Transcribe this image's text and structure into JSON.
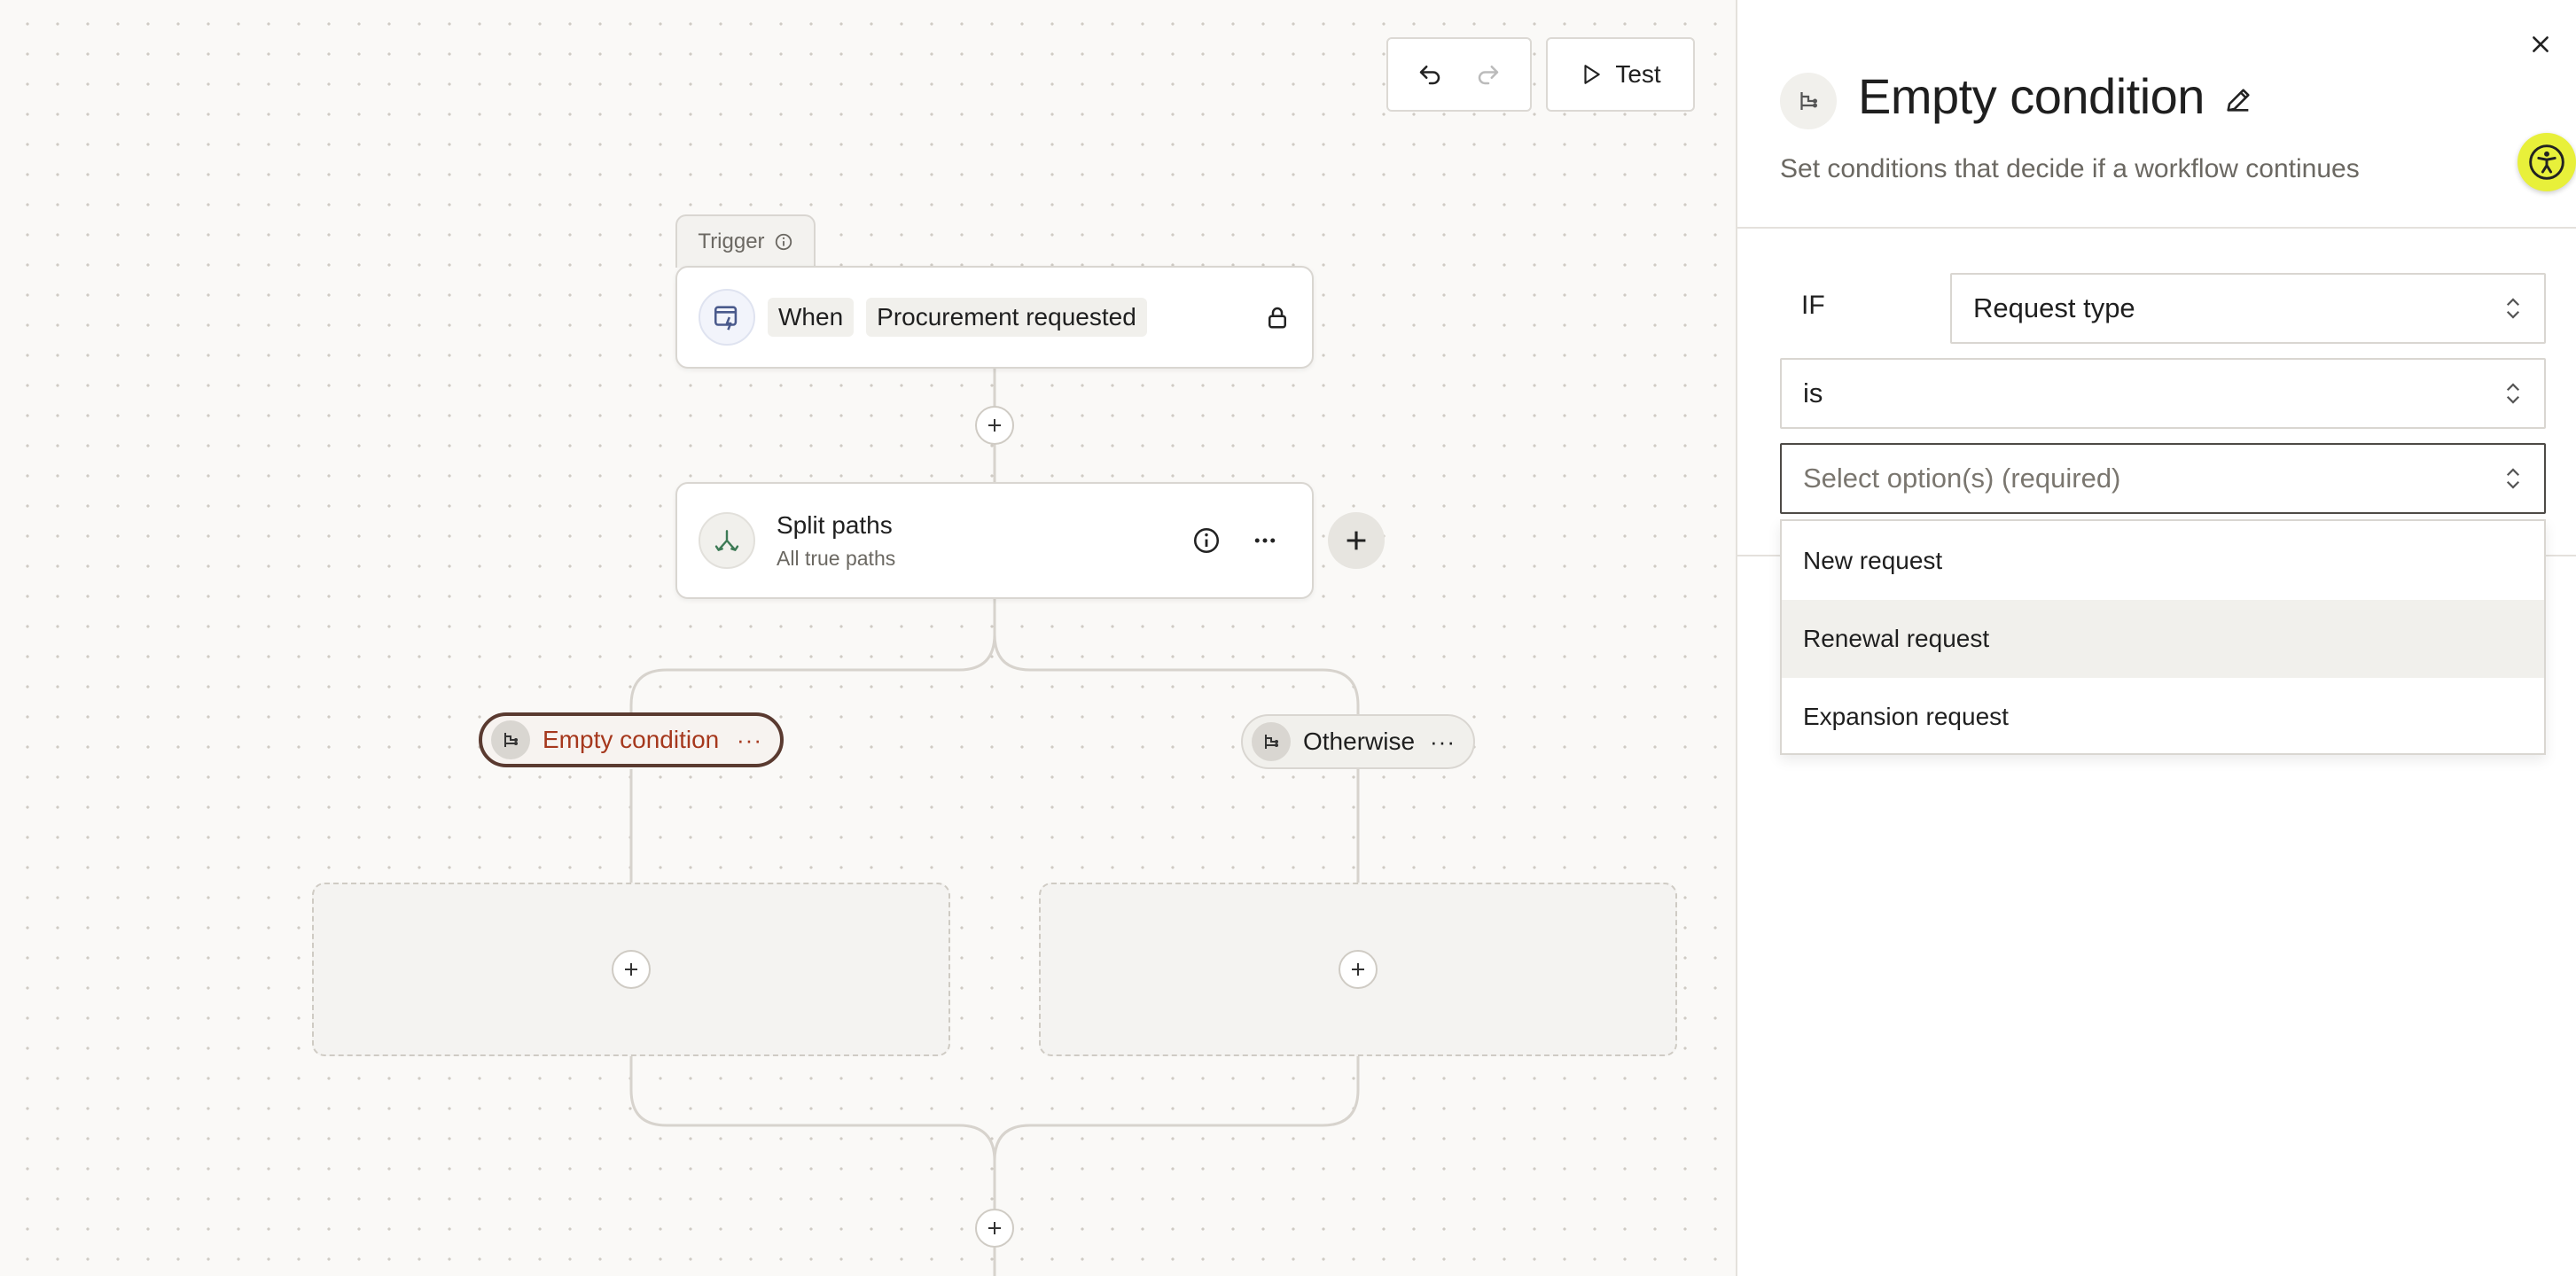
{
  "toolbar": {
    "test_label": "Test"
  },
  "trigger": {
    "tab_label": "Trigger",
    "when_chip": "When",
    "event_chip": "Procurement requested"
  },
  "split": {
    "title": "Split paths",
    "subtitle": "All true paths"
  },
  "conditions": [
    {
      "label": "Empty condition",
      "more": "···"
    },
    {
      "label": "Otherwise",
      "more": "···"
    }
  ],
  "panel": {
    "title": "Empty condition",
    "description": "Set conditions that decide if a workflow continues",
    "if_label": "IF",
    "field_value": "Request type",
    "operator_value": "is",
    "options_placeholder": "Select option(s) (required)",
    "dropdown_options": [
      "New request",
      "Renewal request",
      "Expansion request"
    ],
    "highlighted_option": "Renewal request"
  },
  "colors": {
    "accent_condition_text": "#a6381d",
    "accent_condition_border": "#5a3a30",
    "accessibility_button": "#e8f03a",
    "canvas_background": "#faf9f7"
  }
}
